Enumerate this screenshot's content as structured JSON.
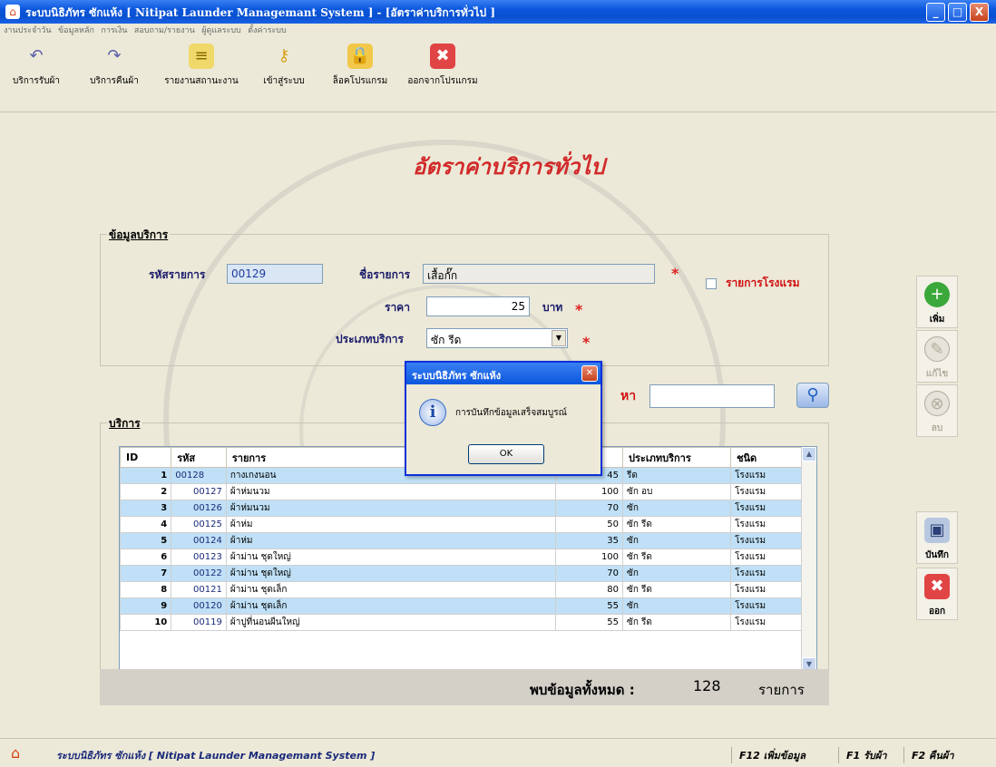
{
  "window": {
    "title": "ระบบนิธิภัทร ซักแห้ง [ Nitipat Launder Managemant System ] - [อัตราค่าบริการทั่วไป ]",
    "minimize": "_",
    "maximize": "□",
    "close": "X"
  },
  "menu": [
    "งานประจำวัน",
    "ข้อมูลหลัก",
    "การเงิน",
    "สอบถาม/รายงาน",
    "ผู้ดูแลระบบ",
    "ตั้งค่าระบบ"
  ],
  "toolbar": {
    "receive": "บริการรับผ้า",
    "return": "บริการคืนผ้า",
    "report": "รายงานสถานะงาน",
    "login": "เข้าสู่ระบบ",
    "lock": "ล็อคโปรแกรม",
    "exit": "ออกจากโปรแกรม"
  },
  "page_title": "อัตราค่าบริการทั่วไป",
  "service_info": {
    "legend": "ข้อมูลบริการ",
    "code_label": "รหัสรายการ",
    "code_value": "00129",
    "name_label": "ชื่อรายการ",
    "name_value": "เสื้อกั๊ก",
    "price_label": "ราคา",
    "price_value": "25",
    "price_unit": "บาท",
    "type_label": "ประเภทบริการ",
    "type_value": "ซัก รีด",
    "hotel_checkbox_label": "รายการโรงแรม",
    "required_mark": "*"
  },
  "search": {
    "label": "หา",
    "value": ""
  },
  "list": {
    "legend": "บริการ",
    "columns": [
      "ID",
      "รหัส",
      "รายการ",
      "",
      "ประเภทบริการ",
      "ชนิด"
    ],
    "rows": [
      {
        "id": "1",
        "code": "00128",
        "name": "กางเกงนอน",
        "price": "45",
        "type": "รีด",
        "kind": "โรงแรม"
      },
      {
        "id": "2",
        "code": "00127",
        "name": "ผ้าห่มนวม",
        "price": "100",
        "type": "ซัก อบ",
        "kind": "โรงแรม"
      },
      {
        "id": "3",
        "code": "00126",
        "name": "ผ้าห่มนวม",
        "price": "70",
        "type": "ซัก",
        "kind": "โรงแรม"
      },
      {
        "id": "4",
        "code": "00125",
        "name": "ผ้าห่ม",
        "price": "50",
        "type": "ซัก รีด",
        "kind": "โรงแรม"
      },
      {
        "id": "5",
        "code": "00124",
        "name": "ผ้าห่ม",
        "price": "35",
        "type": "ซัก",
        "kind": "โรงแรม"
      },
      {
        "id": "6",
        "code": "00123",
        "name": "ผ้าม่าน ชุดใหญ่",
        "price": "100",
        "type": "ซัก รีด",
        "kind": "โรงแรม"
      },
      {
        "id": "7",
        "code": "00122",
        "name": "ผ้าม่าน ชุดใหญ่",
        "price": "70",
        "type": "ซัก",
        "kind": "โรงแรม"
      },
      {
        "id": "8",
        "code": "00121",
        "name": "ผ้าม่าน ชุดเล็ก",
        "price": "80",
        "type": "ซัก รีด",
        "kind": "โรงแรม"
      },
      {
        "id": "9",
        "code": "00120",
        "name": "ผ้าม่าน ชุดเล็ก",
        "price": "55",
        "type": "ซัก",
        "kind": "โรงแรม"
      },
      {
        "id": "10",
        "code": "00119",
        "name": "ผ้าปูที่นอนผืนใหญ่",
        "price": "55",
        "type": "ซัก รีด",
        "kind": "โรงแรม"
      }
    ]
  },
  "total": {
    "label": "พบข้อมูลทั้งหมด :",
    "count": "128",
    "unit": "รายการ"
  },
  "side_buttons": {
    "add": "เพิ่ม",
    "edit": "แก้ไข",
    "delete": "ลบ",
    "save": "บันทึก",
    "exit": "ออก"
  },
  "dialog": {
    "title": "ระบบนิธิภัทร ซักแห้ง",
    "message": "การบันทึกข้อมูลเสร็จสมบูรณ์",
    "ok": "OK"
  },
  "statusbar": {
    "app": "ระบบนิธิภัทร ซักแห้ง [ Nitipat Launder Managemant System ]",
    "f12": "F12 เพิ่มข้อมูล",
    "f1": "F1 รับผ้า",
    "f2": "F2 คืนผ้า"
  }
}
